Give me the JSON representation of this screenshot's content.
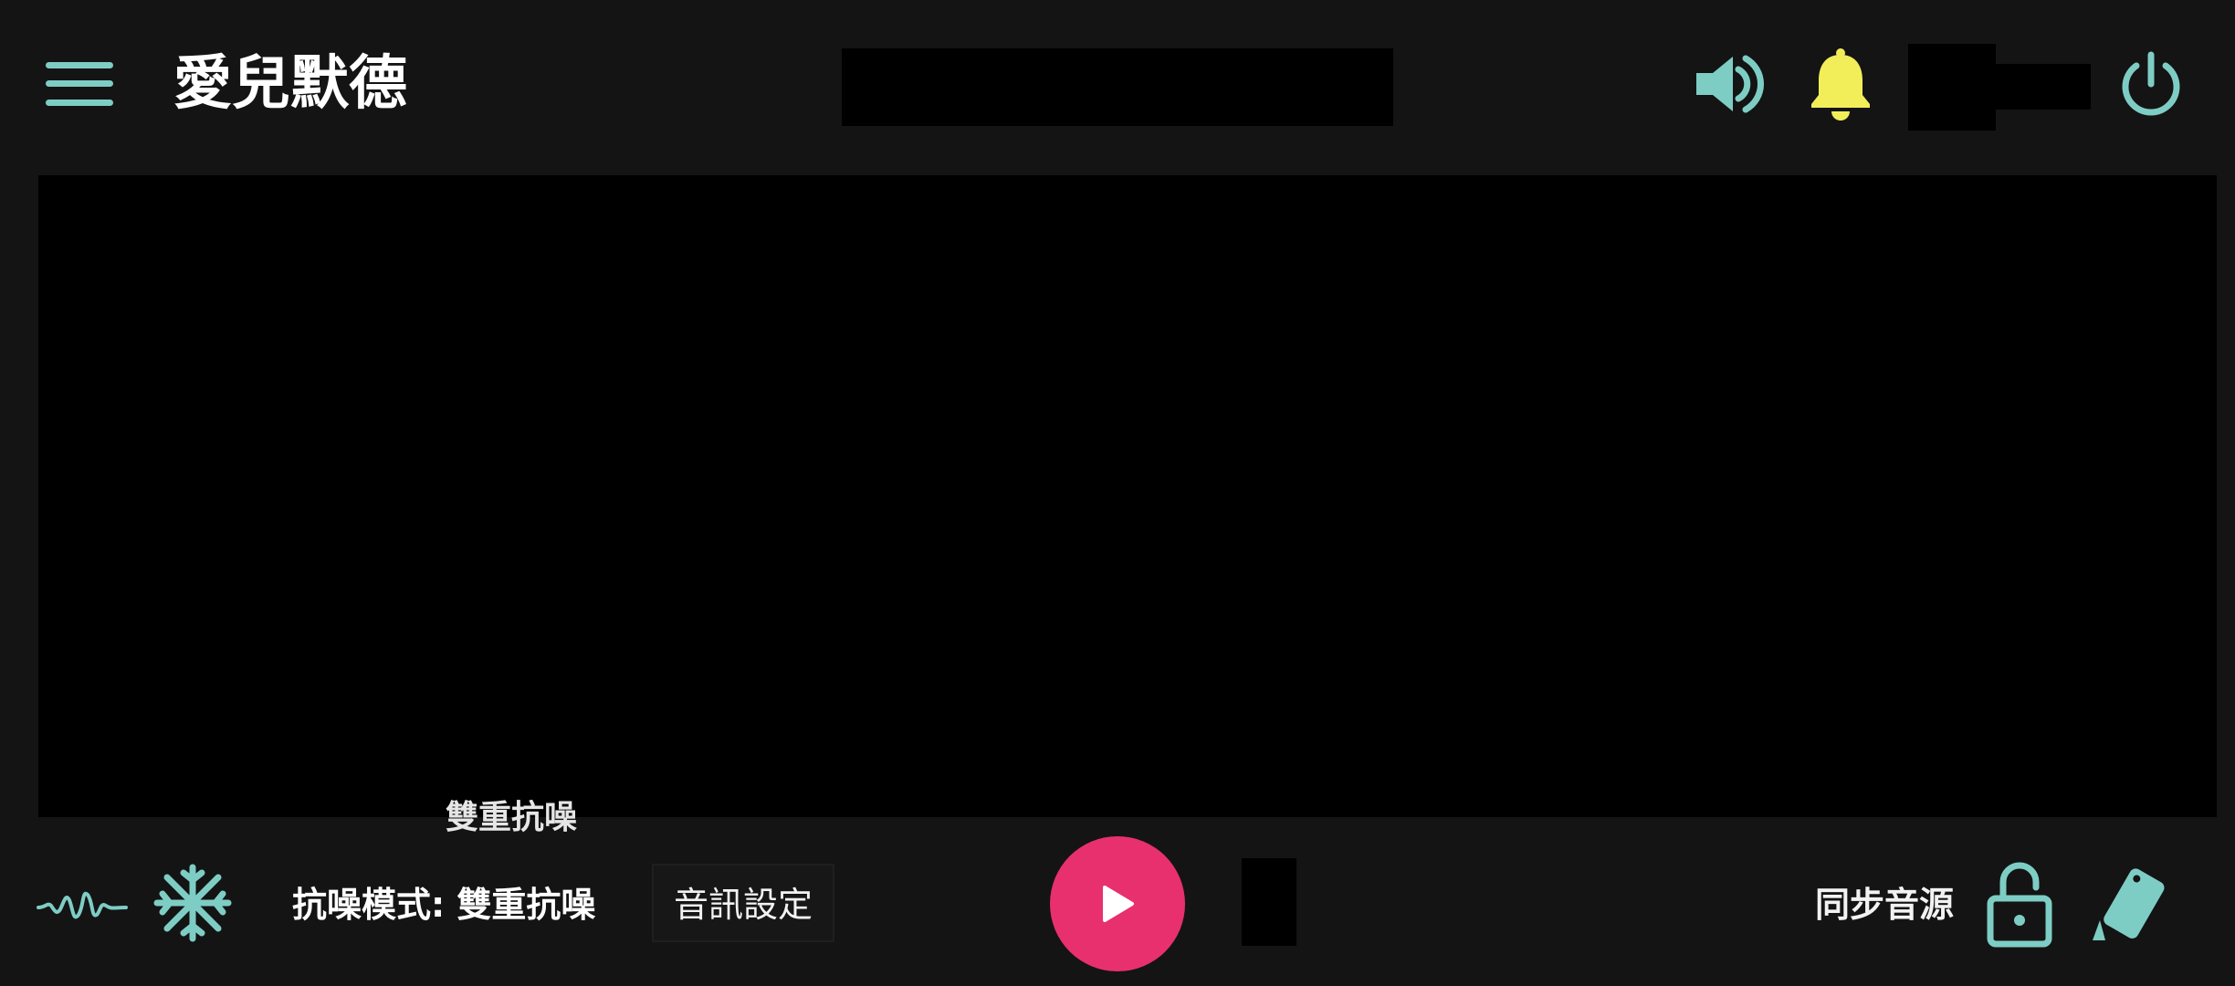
{
  "header": {
    "title": "愛兒默德",
    "icons": {
      "menu": "menu-icon",
      "volume": "volume-icon",
      "bell": "bell-icon",
      "power": "power-icon"
    }
  },
  "main": {
    "peek_text": "雙重抗噪"
  },
  "footer": {
    "anc_label": "抗噪模式: 雙重抗噪",
    "audio_settings_label": "音訊設定",
    "sync_label": "同步音源",
    "icons": {
      "wave": "waveform-icon",
      "snow": "snowflake-icon",
      "play": "play-icon",
      "lock": "unlock-icon",
      "phone": "phone-shake-icon"
    }
  },
  "colors": {
    "background": "#141414",
    "accent": "#7ecdc5",
    "bell": "#f2ee5a",
    "play": "#e8306f",
    "text": "#ffffff"
  }
}
